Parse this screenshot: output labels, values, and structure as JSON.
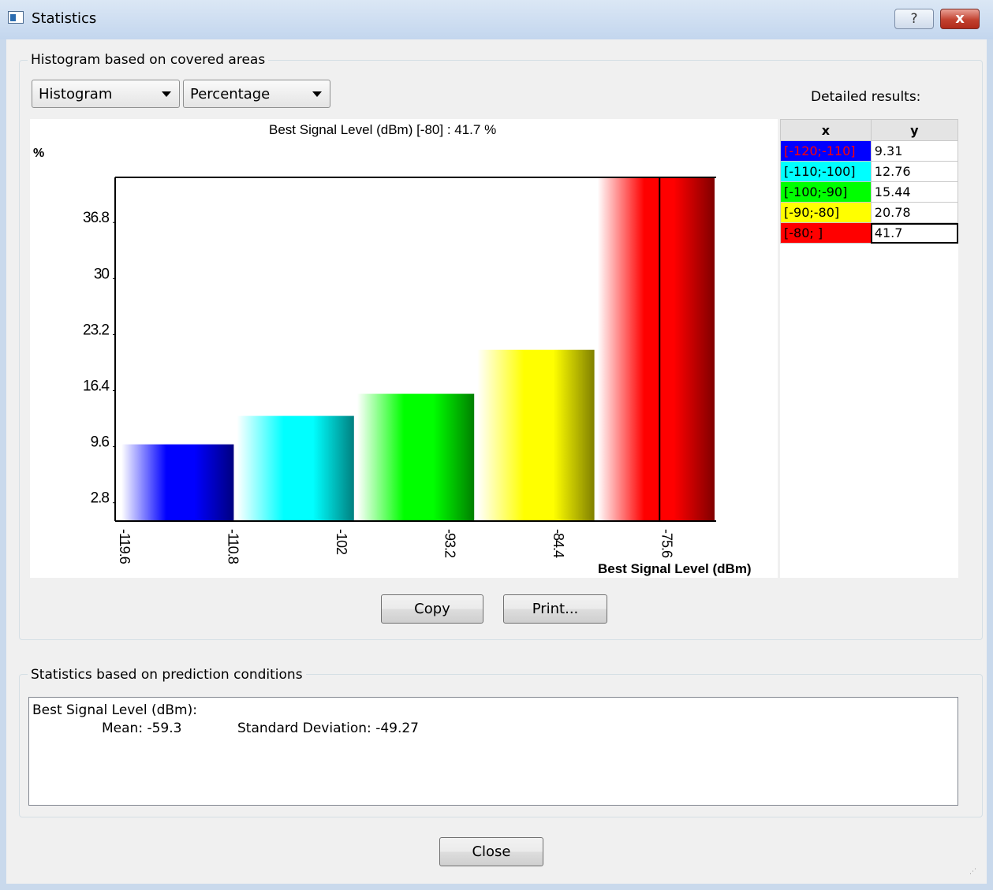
{
  "window": {
    "title": "Statistics",
    "help_label": "?",
    "close_label": "x"
  },
  "histogram_group": {
    "label": "Histogram based on covered areas",
    "mode_combo": {
      "value": "Histogram"
    },
    "unit_combo": {
      "value": "Percentage"
    },
    "detailed_label": "Detailed results:",
    "copy_label": "Copy",
    "print_label": "Print..."
  },
  "chart_data": {
    "type": "bar",
    "title": "Best Signal Level (dBm) [-80] : 41.7 %",
    "ylabel": "%",
    "xlabel": "Best Signal Level (dBm)",
    "y_ticks": [
      "36.8",
      "30",
      "23.2",
      "16.4",
      "9.6",
      "2.8"
    ],
    "y_tick_values": [
      36.8,
      30,
      23.2,
      16.4,
      9.6,
      2.8
    ],
    "x_ticks": [
      "-119.6",
      "-110.8",
      "-102",
      "-93.2",
      "-84.4",
      "-75.6"
    ],
    "ylim": [
      0,
      41.7
    ],
    "categories": [
      "[-120;-110]",
      "[-110;-100]",
      "[-100;-90]",
      "[-90;-80]",
      "[-80; ]"
    ],
    "values": [
      9.31,
      12.76,
      15.44,
      20.78,
      41.7
    ],
    "colors": [
      "#0000ff",
      "#00ffff",
      "#00ff00",
      "#ffff00",
      "#ff0000"
    ],
    "dark_colors": [
      "#000080",
      "#008080",
      "#008000",
      "#808000",
      "#800000"
    ],
    "selected_index": 4
  },
  "results_table": {
    "headers": [
      "x",
      "y"
    ],
    "rows": [
      {
        "x": "[-120;-110]",
        "y": "9.31",
        "color": "#0000ff",
        "text_color": "#ff0000"
      },
      {
        "x": "[-110;-100]",
        "y": "12.76",
        "color": "#00ffff",
        "text_color": "#000000"
      },
      {
        "x": "[-100;-90]",
        "y": "15.44",
        "color": "#00ff00",
        "text_color": "#000000"
      },
      {
        "x": "[-90;-80]",
        "y": "20.78",
        "color": "#ffff00",
        "text_color": "#000000"
      },
      {
        "x": "[-80;   ]",
        "y": "41.7",
        "color": "#ff0000",
        "text_color": "#000000"
      }
    ]
  },
  "stats_group": {
    "label": "Statistics based on prediction conditions",
    "line1": "Best Signal Level (dBm):",
    "mean_label": "Mean: -59.3",
    "std_label": "Standard Deviation: -49.27"
  },
  "footer": {
    "close_label": "Close"
  }
}
